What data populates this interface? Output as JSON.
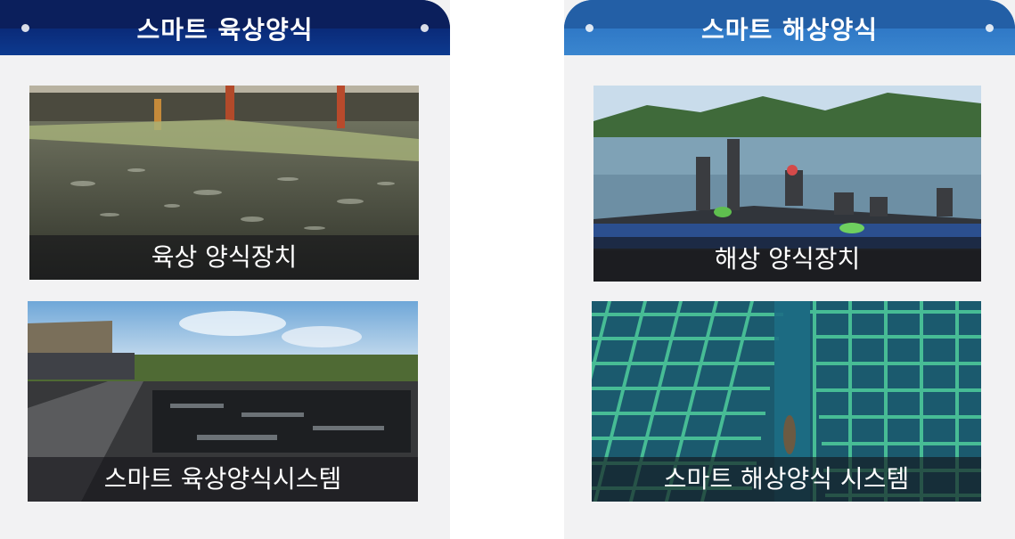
{
  "left_panel": {
    "title": "스마트 육상양식",
    "cards": [
      {
        "caption": "육상 양식장치"
      },
      {
        "caption": "스마트 육상양식시스템"
      }
    ]
  },
  "right_panel": {
    "title": "스마트 해상양식",
    "cards": [
      {
        "caption": "해상 양식장치"
      },
      {
        "caption": "스마트 해상양식 시스템"
      }
    ]
  }
}
